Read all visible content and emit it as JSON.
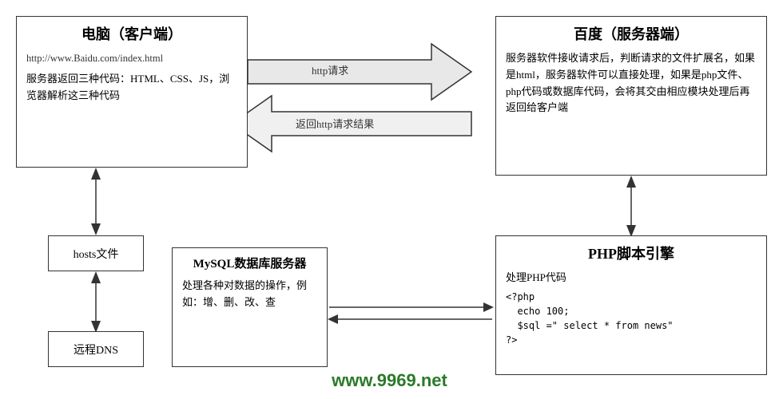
{
  "client": {
    "title": "电脑（客户端）",
    "url": "http://www.Baidu.com/index.html",
    "description": "服务器返回三种代码：HTML、CSS、JS，浏览器解析这三种代码"
  },
  "server": {
    "title": "百度（服务器端）",
    "description": "服务器软件接收请求后，判断请求的文件扩展名，如果是html，服务器软件可以直接处理，如果是php文件、php代码或数据库代码，会将其交由相应模块处理后再返回给客户端"
  },
  "hosts": {
    "label": "hosts文件"
  },
  "dns": {
    "label": "远程DNS"
  },
  "mysql": {
    "title": "MySQL数据库服务器",
    "description": "处理各种对数据的操作，例如：增、删、改、查"
  },
  "php": {
    "title": "PHP脚本引擎",
    "description": "处理PHP代码",
    "code": "<?php\n  echo 100;\n  $sql =\" select * from news\"\n?>"
  },
  "arrows": {
    "http_request": "http请求",
    "http_response": "返回http请求结果"
  },
  "watermark": "www.9969.net"
}
